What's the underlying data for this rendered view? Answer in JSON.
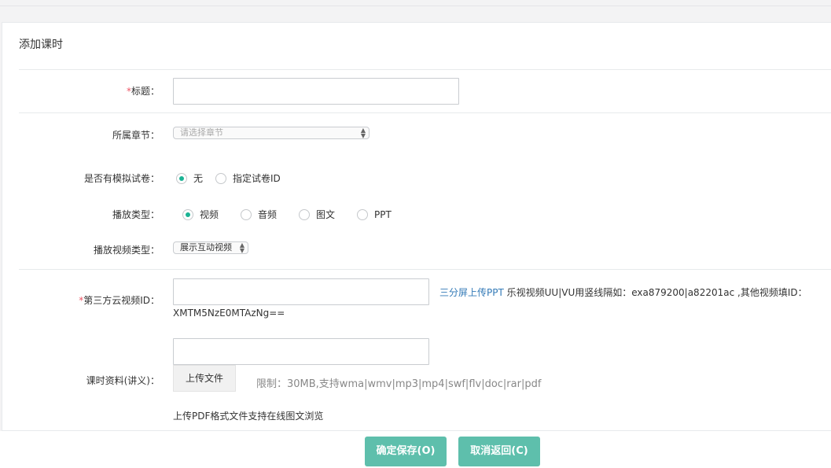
{
  "page": {
    "title": "添加课时"
  },
  "form": {
    "title_label": "标题：",
    "title_required": "*",
    "title_value": "",
    "chapter_label": "所属章节：",
    "chapter_placeholder": "请选择章节",
    "mock_label": "是否有模拟试卷：",
    "mock_options": [
      "无",
      "指定试卷ID"
    ],
    "play_type_label": "播放类型：",
    "play_type_options": [
      "视频",
      "音频",
      "图文",
      "PPT"
    ],
    "video_type_label": "播放视频类型：",
    "video_type_value": "展示互动视频",
    "thirdparty_label": "第三方云视频ID：",
    "thirdparty_required": "*",
    "thirdparty_value": "",
    "thirdparty_hint_link": "三分屏上传PPT",
    "thirdparty_hint_text": " 乐视视频UU|VU用竖线隔如：exa879200|a82201ac ,其他视频填ID：",
    "thirdparty_hint_example": "XMTM5NzE0MTAzNg==",
    "material_label": "课时资料(讲义)：",
    "upload_button": "上传文件",
    "upload_limit": "限制：30MB,支持wma|wmv|mp3|mp4|swf|flv|doc|rar|pdf",
    "upload_note": "上传PDF格式文件支持在线图文浏览"
  },
  "footer": {
    "save_button": "确定保存(O)",
    "cancel_button": "取消返回(C)"
  },
  "colors": {
    "accent": "#1ab394",
    "button": "#5ebfac",
    "required": "#ed5565",
    "link": "#337ab7"
  }
}
